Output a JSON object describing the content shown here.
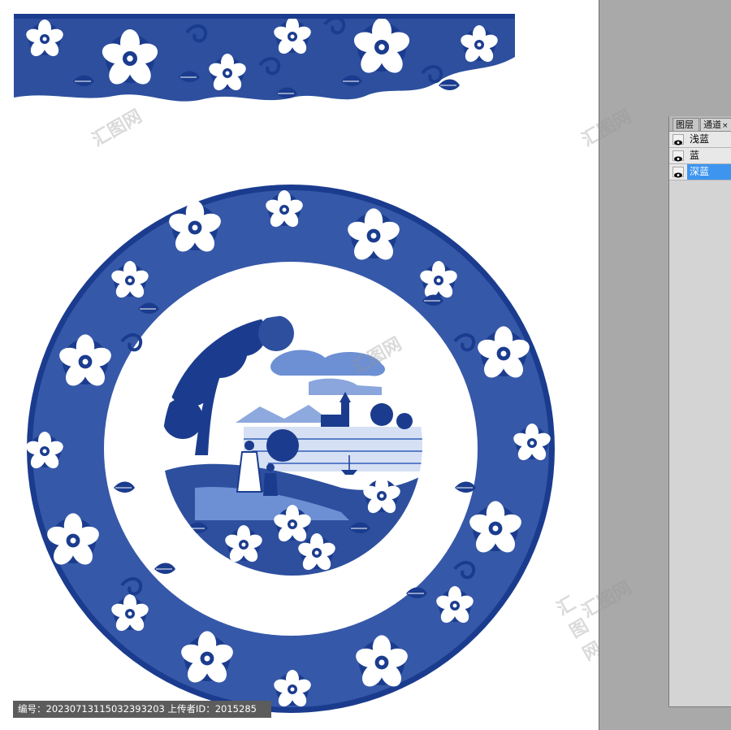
{
  "panel": {
    "tabs": [
      {
        "label": "图层"
      },
      {
        "label": "通道"
      }
    ],
    "close_symbol": "×",
    "channels": [
      {
        "label": "浅蓝",
        "visible": true,
        "selected": false
      },
      {
        "label": "蓝",
        "visible": true,
        "selected": false
      },
      {
        "label": "深蓝",
        "visible": true,
        "selected": true
      }
    ]
  },
  "credit": {
    "text": "编号：20230713115032393203  上传者ID：2015285"
  },
  "colors": {
    "porcelain_blue": "#1b3c8e",
    "light_blue": "#5b7fc8",
    "selection": "#3d95f0"
  },
  "icons": {
    "eye": "eye-icon"
  }
}
